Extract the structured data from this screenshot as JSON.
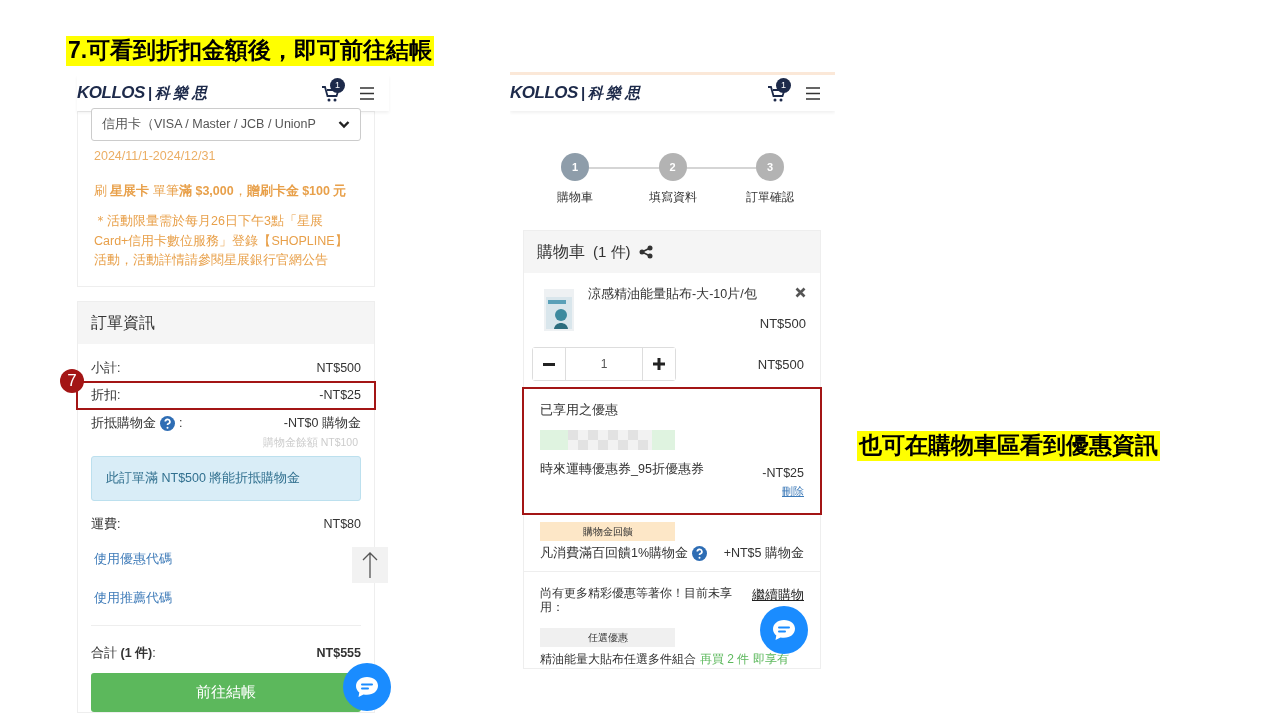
{
  "slide_caption": "7.可看到折扣金額後，即可前往結帳",
  "side_caption": "也可在購物車區看到優惠資訊",
  "left_phone": {
    "header": {
      "logo_latin": "KOLLOS",
      "logo_cjk": "| 科 樂 思",
      "cart_count": "1"
    },
    "payment_select": {
      "value": "信用卡（VISA / Master / JCB / UnionP"
    },
    "promo_dates": "2024/11/1-2024/12/31",
    "promo_offer": "刷 **星展卡** 單筆**滿 $3,000**，**贈刷卡金 $100 元**",
    "promo_note": "＊活動限量需於每月26日下午3點「星展Card+信用卡數位服務」登錄【SHOPLINE】活動，活動詳情請參閱星展銀行官網公告",
    "order_panel": {
      "title": "訂單資訊",
      "rows": [
        {
          "label": "小計:",
          "value": "NT$500",
          "highlighted": false
        },
        {
          "label": "折扣:",
          "value": "-NT$25",
          "highlighted": true
        }
      ],
      "step_marker": "7",
      "credit_row": {
        "label": "折抵購物金",
        "suffix": ":",
        "value": "-NT$0 購物金",
        "note": "購物金餘額 NT$100"
      },
      "alert": "此訂單滿 NT$500 將能折抵購物金",
      "shipping": {
        "label": "運費:",
        "value": "NT$80"
      },
      "links": [
        "使用優惠代碼",
        "使用推薦代碼"
      ],
      "total": {
        "label": "合計 **(1 件)**:",
        "value": "NT$555"
      },
      "checkout_button": "前往結帳"
    }
  },
  "right_phone": {
    "header": {
      "logo_latin": "KOLLOS",
      "logo_cjk": "| 科 樂 思",
      "cart_count": "1"
    },
    "steps": [
      {
        "number": "1",
        "label": "購物車",
        "selected": true
      },
      {
        "number": "2",
        "label": "填寫資料",
        "selected": false
      },
      {
        "number": "3",
        "label": "訂單確認",
        "selected": false
      }
    ],
    "cart": {
      "title": "購物車",
      "count": "(1 件)",
      "item": {
        "name": "涼感精油能量貼布-大-10片/包",
        "unit_price": "NT$500",
        "quantity": "1",
        "line_total": "NT$500"
      },
      "applied_offers": {
        "title": "已享用之優惠",
        "coupon": "時來運轉優惠券_95折優惠券",
        "amount": "-NT$25",
        "remove": "刪除",
        "highlighted": true
      },
      "cashback": {
        "tag": "購物金回饋",
        "text": "凡消費滿百回饋1%購物金",
        "value": "+NT$5 購物金"
      },
      "more": {
        "text": "尚有更多精彩優惠等著你！目前未享用：",
        "link": "繼續購物",
        "tag": "任選優惠",
        "offer": "精油能量大貼布任選多件組合",
        "offer_hint": "再買 2 件 即享有"
      }
    }
  }
}
